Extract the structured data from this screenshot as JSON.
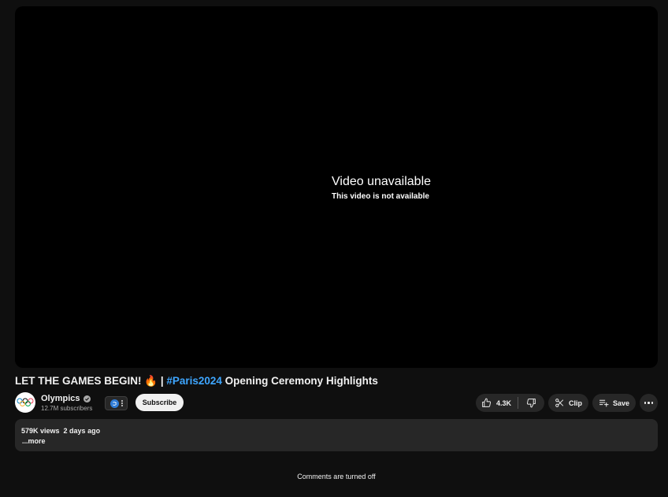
{
  "player": {
    "message_title": "Video unavailable",
    "message_subtitle": "This video is not available"
  },
  "video": {
    "title_pre": "LET THE GAMES BEGIN! 🔥 | ",
    "title_hashtag": "#Paris2024",
    "title_post": " Opening Ceremony Highlights"
  },
  "channel": {
    "name": "Olympics",
    "subscribers": "12.7M subscribers",
    "avatar_icon": "olympic-rings-icon",
    "verified_icon": "verified-check-icon"
  },
  "actions": {
    "subscribe_label": "Subscribe",
    "like_count": "4.3K",
    "clip_label": "Clip",
    "save_label": "Save"
  },
  "description": {
    "views": "579K views",
    "date": "2 days ago",
    "more_label": "...more"
  },
  "comments": {
    "status": "Comments are turned off"
  },
  "colors": {
    "background": "#0f0f0f",
    "surface": "#272727",
    "hashtag": "#3ea6ff",
    "text": "#f1f1f1",
    "muted_text": "#aaaaaa"
  }
}
